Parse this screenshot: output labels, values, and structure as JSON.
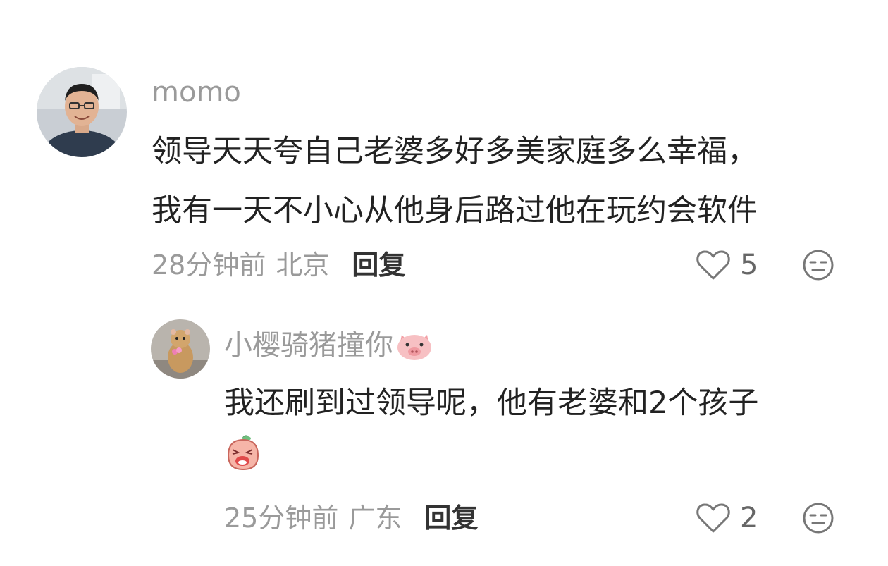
{
  "comments": [
    {
      "username": "momo",
      "avatar": "man-portrait-avatar",
      "lines": [
        "领导天天夸自己老婆多好多美家庭多么幸福，",
        "我有一天不小心从他身后路过他在玩约会软件"
      ],
      "time": "28分钟前",
      "location": "北京",
      "reply_label": "回复",
      "like_count": "5",
      "icons": {
        "like": "heart-outline-icon",
        "dislike": "unamused-face-icon"
      }
    },
    {
      "username": "小樱骑猪撞你",
      "username_emoji": "pig-face-emoji",
      "avatar": "hamster-avatar",
      "lines": [
        "我还刷到过领导呢，他有老婆和2个孩子"
      ],
      "inline_emoji": "crying-peach-emoji",
      "time": "25分钟前",
      "location": "广东",
      "reply_label": "回复",
      "like_count": "2",
      "icons": {
        "like": "heart-outline-icon",
        "dislike": "unamused-face-icon"
      }
    }
  ],
  "colors": {
    "secondary_text": "#9a9a9a",
    "primary_text": "#222222",
    "icon_stroke": "#777777"
  }
}
